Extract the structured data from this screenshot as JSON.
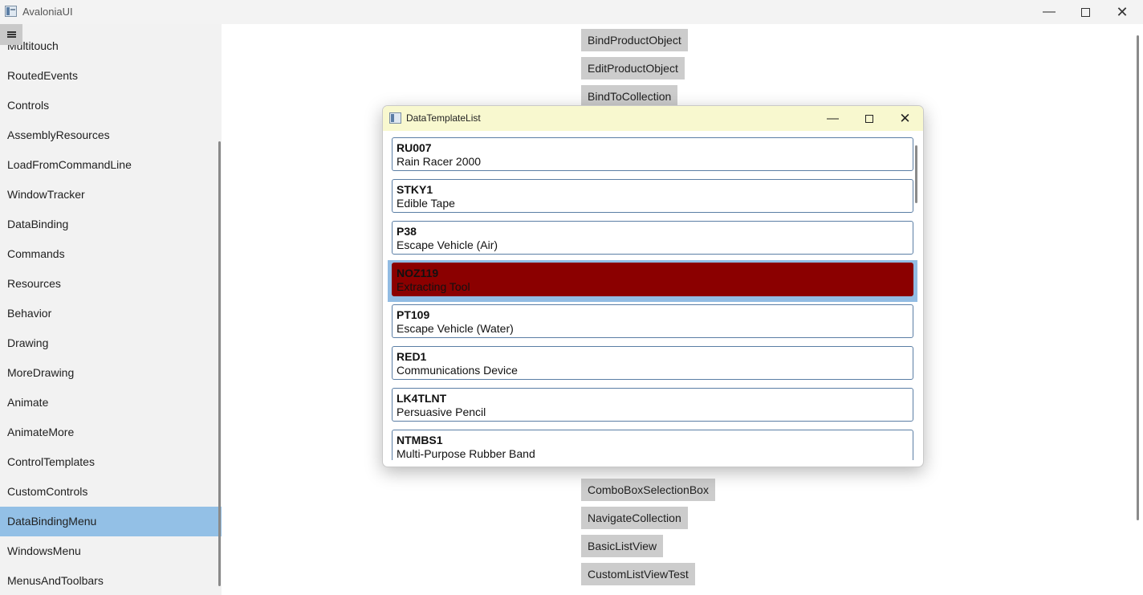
{
  "window": {
    "title": "AvaloniaUI"
  },
  "sidebar": {
    "items": [
      {
        "label": "Multitouch",
        "selected": false
      },
      {
        "label": "RoutedEvents",
        "selected": false
      },
      {
        "label": "Controls",
        "selected": false
      },
      {
        "label": "AssemblyResources",
        "selected": false
      },
      {
        "label": "LoadFromCommandLine",
        "selected": false
      },
      {
        "label": "WindowTracker",
        "selected": false
      },
      {
        "label": "DataBinding",
        "selected": false
      },
      {
        "label": "Commands",
        "selected": false
      },
      {
        "label": "Resources",
        "selected": false
      },
      {
        "label": "Behavior",
        "selected": false
      },
      {
        "label": "Drawing",
        "selected": false
      },
      {
        "label": "MoreDrawing",
        "selected": false
      },
      {
        "label": "Animate",
        "selected": false
      },
      {
        "label": "AnimateMore",
        "selected": false
      },
      {
        "label": "ControlTemplates",
        "selected": false
      },
      {
        "label": "CustomControls",
        "selected": false
      },
      {
        "label": "DataBindingMenu",
        "selected": true
      },
      {
        "label": "WindowsMenu",
        "selected": false
      },
      {
        "label": "MenusAndToolbars",
        "selected": false
      }
    ]
  },
  "main": {
    "buttons_top": [
      "BindProductObject",
      "EditProductObject",
      "BindToCollection"
    ],
    "buttons_bottom": [
      "ComboBoxSelectionBox",
      "NavigateCollection",
      "BasicListView",
      "CustomListViewTest"
    ]
  },
  "dialog": {
    "title": "DataTemplateList",
    "items": [
      {
        "code": "RU007",
        "name": "Rain Racer 2000",
        "selected": false
      },
      {
        "code": "STKY1",
        "name": "Edible Tape",
        "selected": false
      },
      {
        "code": "P38",
        "name": "Escape Vehicle (Air)",
        "selected": false
      },
      {
        "code": "NOZ119",
        "name": "Extracting Tool",
        "selected": true
      },
      {
        "code": "PT109",
        "name": "Escape Vehicle (Water)",
        "selected": false
      },
      {
        "code": "RED1",
        "name": "Communications Device",
        "selected": false
      },
      {
        "code": "LK4TLNT",
        "name": "Persuasive Pencil",
        "selected": false
      },
      {
        "code": "NTMBS1",
        "name": "Multi-Purpose Rubber Band",
        "selected": false
      }
    ]
  },
  "colors": {
    "sidebar_selected": "#93c0e6",
    "dialog_title_bg": "#f8f8cf",
    "item_selected_bg": "#8b0000",
    "item_border": "#5b7ea5"
  }
}
